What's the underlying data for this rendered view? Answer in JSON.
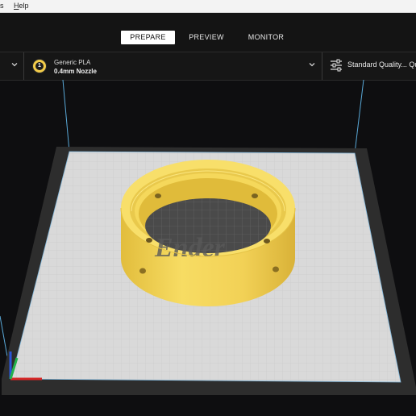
{
  "menu": {
    "partial_item": "s",
    "help_label": "Help"
  },
  "stages": [
    {
      "label": "PREPARE",
      "active": true
    },
    {
      "label": "PREVIEW",
      "active": false
    },
    {
      "label": "MONITOR",
      "active": false
    }
  ],
  "extruder": {
    "number": "1",
    "material": "Generic PLA",
    "nozzle": "0.4mm Nozzle"
  },
  "print_settings": {
    "profile": "Standard Quality... Qu"
  },
  "scene": {
    "model_color": "#f2d156",
    "plate_color": "#d9d9d9",
    "plate_logo_text": "Ender",
    "icons": [
      "chevron-down-icon",
      "sliders-icon",
      "axis-gizmo-icon",
      "mounting-hole-icon"
    ]
  }
}
